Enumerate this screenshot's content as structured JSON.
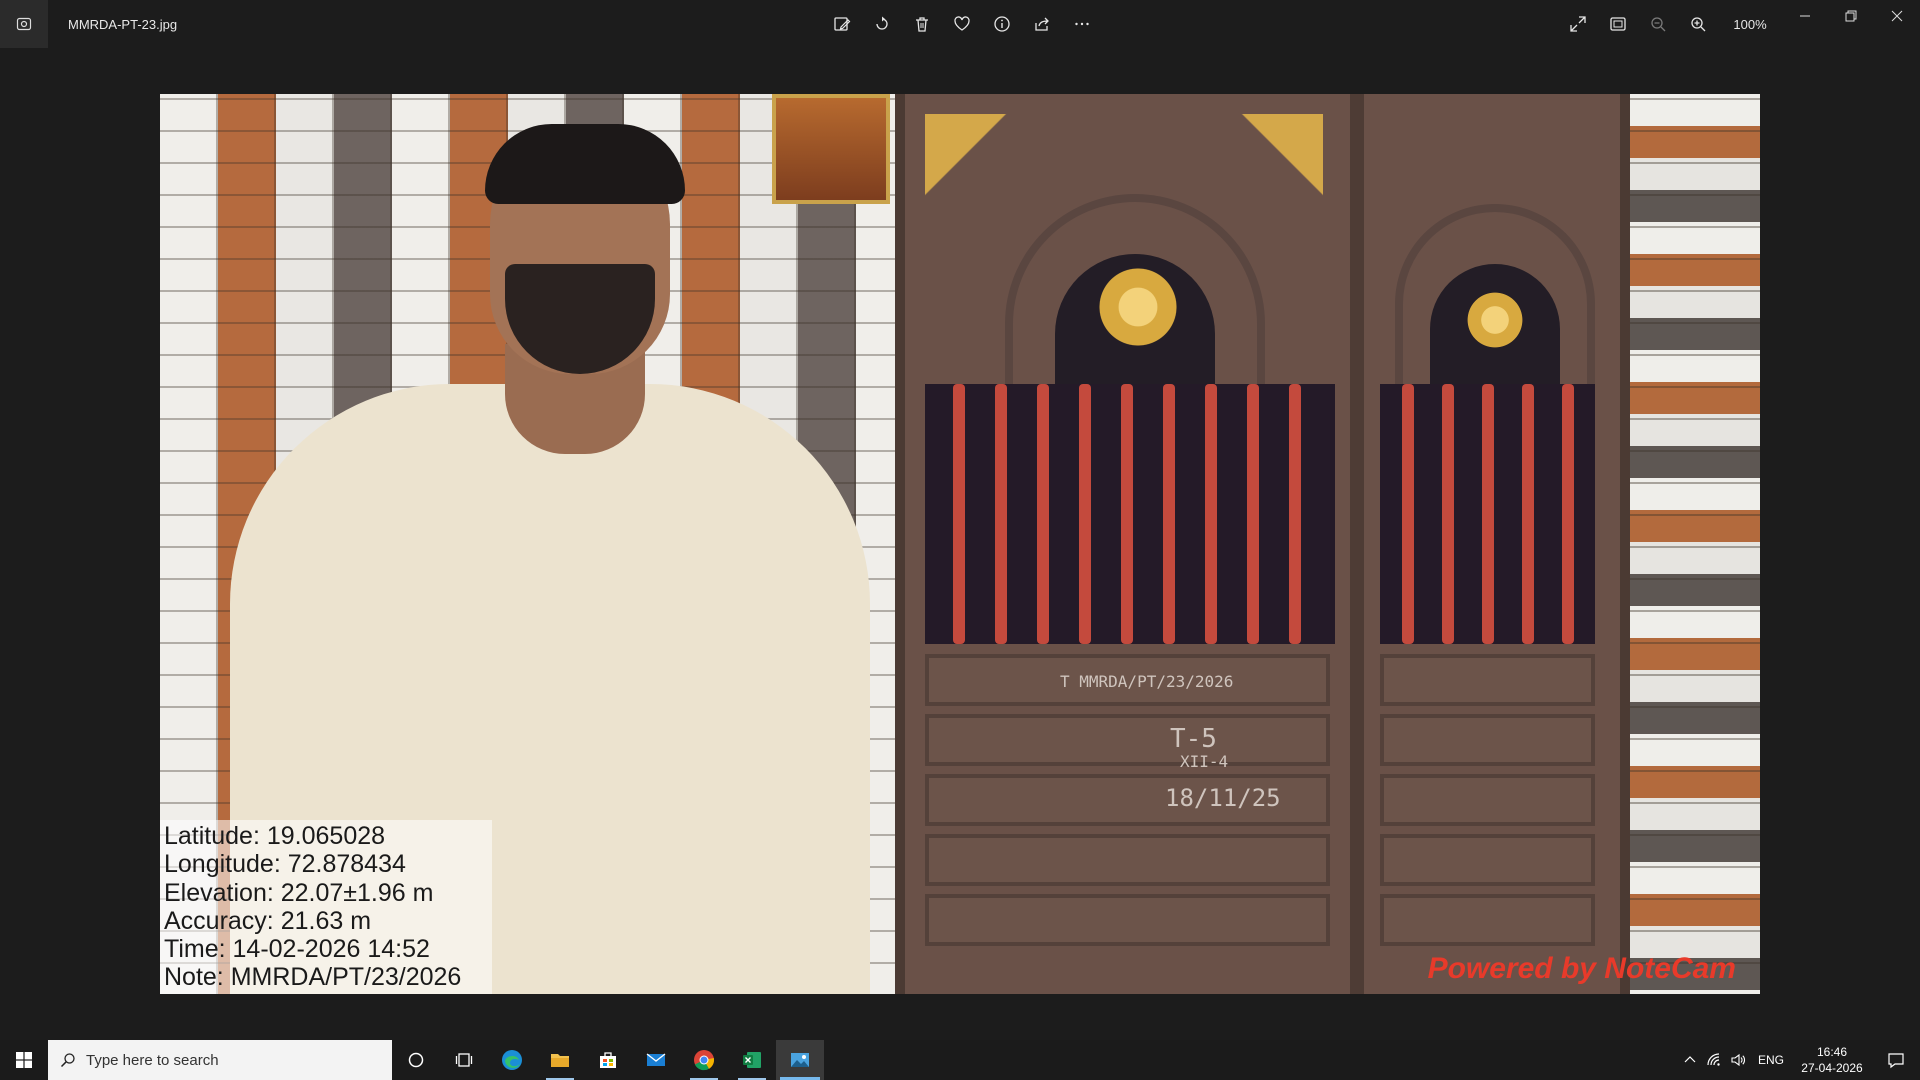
{
  "titlebar": {
    "file_name": "MMRDA-PT-23.jpg",
    "zoom": "100%"
  },
  "photo": {
    "geo": {
      "latitude": "Latitude: 19.065028",
      "longitude": "Longitude: 72.878434",
      "elevation": "Elevation: 22.07±1.96 m",
      "accuracy": "Accuracy: 21.63 m",
      "time": "Time: 14-02-2026 14:52",
      "note": "Note: MMRDA/PT/23/2026"
    },
    "watermark": "Powered by NoteCam",
    "door_text": {
      "line1": "T MMRDA/PT/23/2026",
      "line2": "T-5",
      "line3": "XII-4",
      "line4": "18/11/25"
    }
  },
  "taskbar": {
    "search_placeholder": "Type here to search",
    "lang": "ENG",
    "time": "16:46",
    "date": "27-04-2026"
  },
  "colors": {
    "accent": "#76b9ed",
    "watermark": "#e83a2a"
  }
}
